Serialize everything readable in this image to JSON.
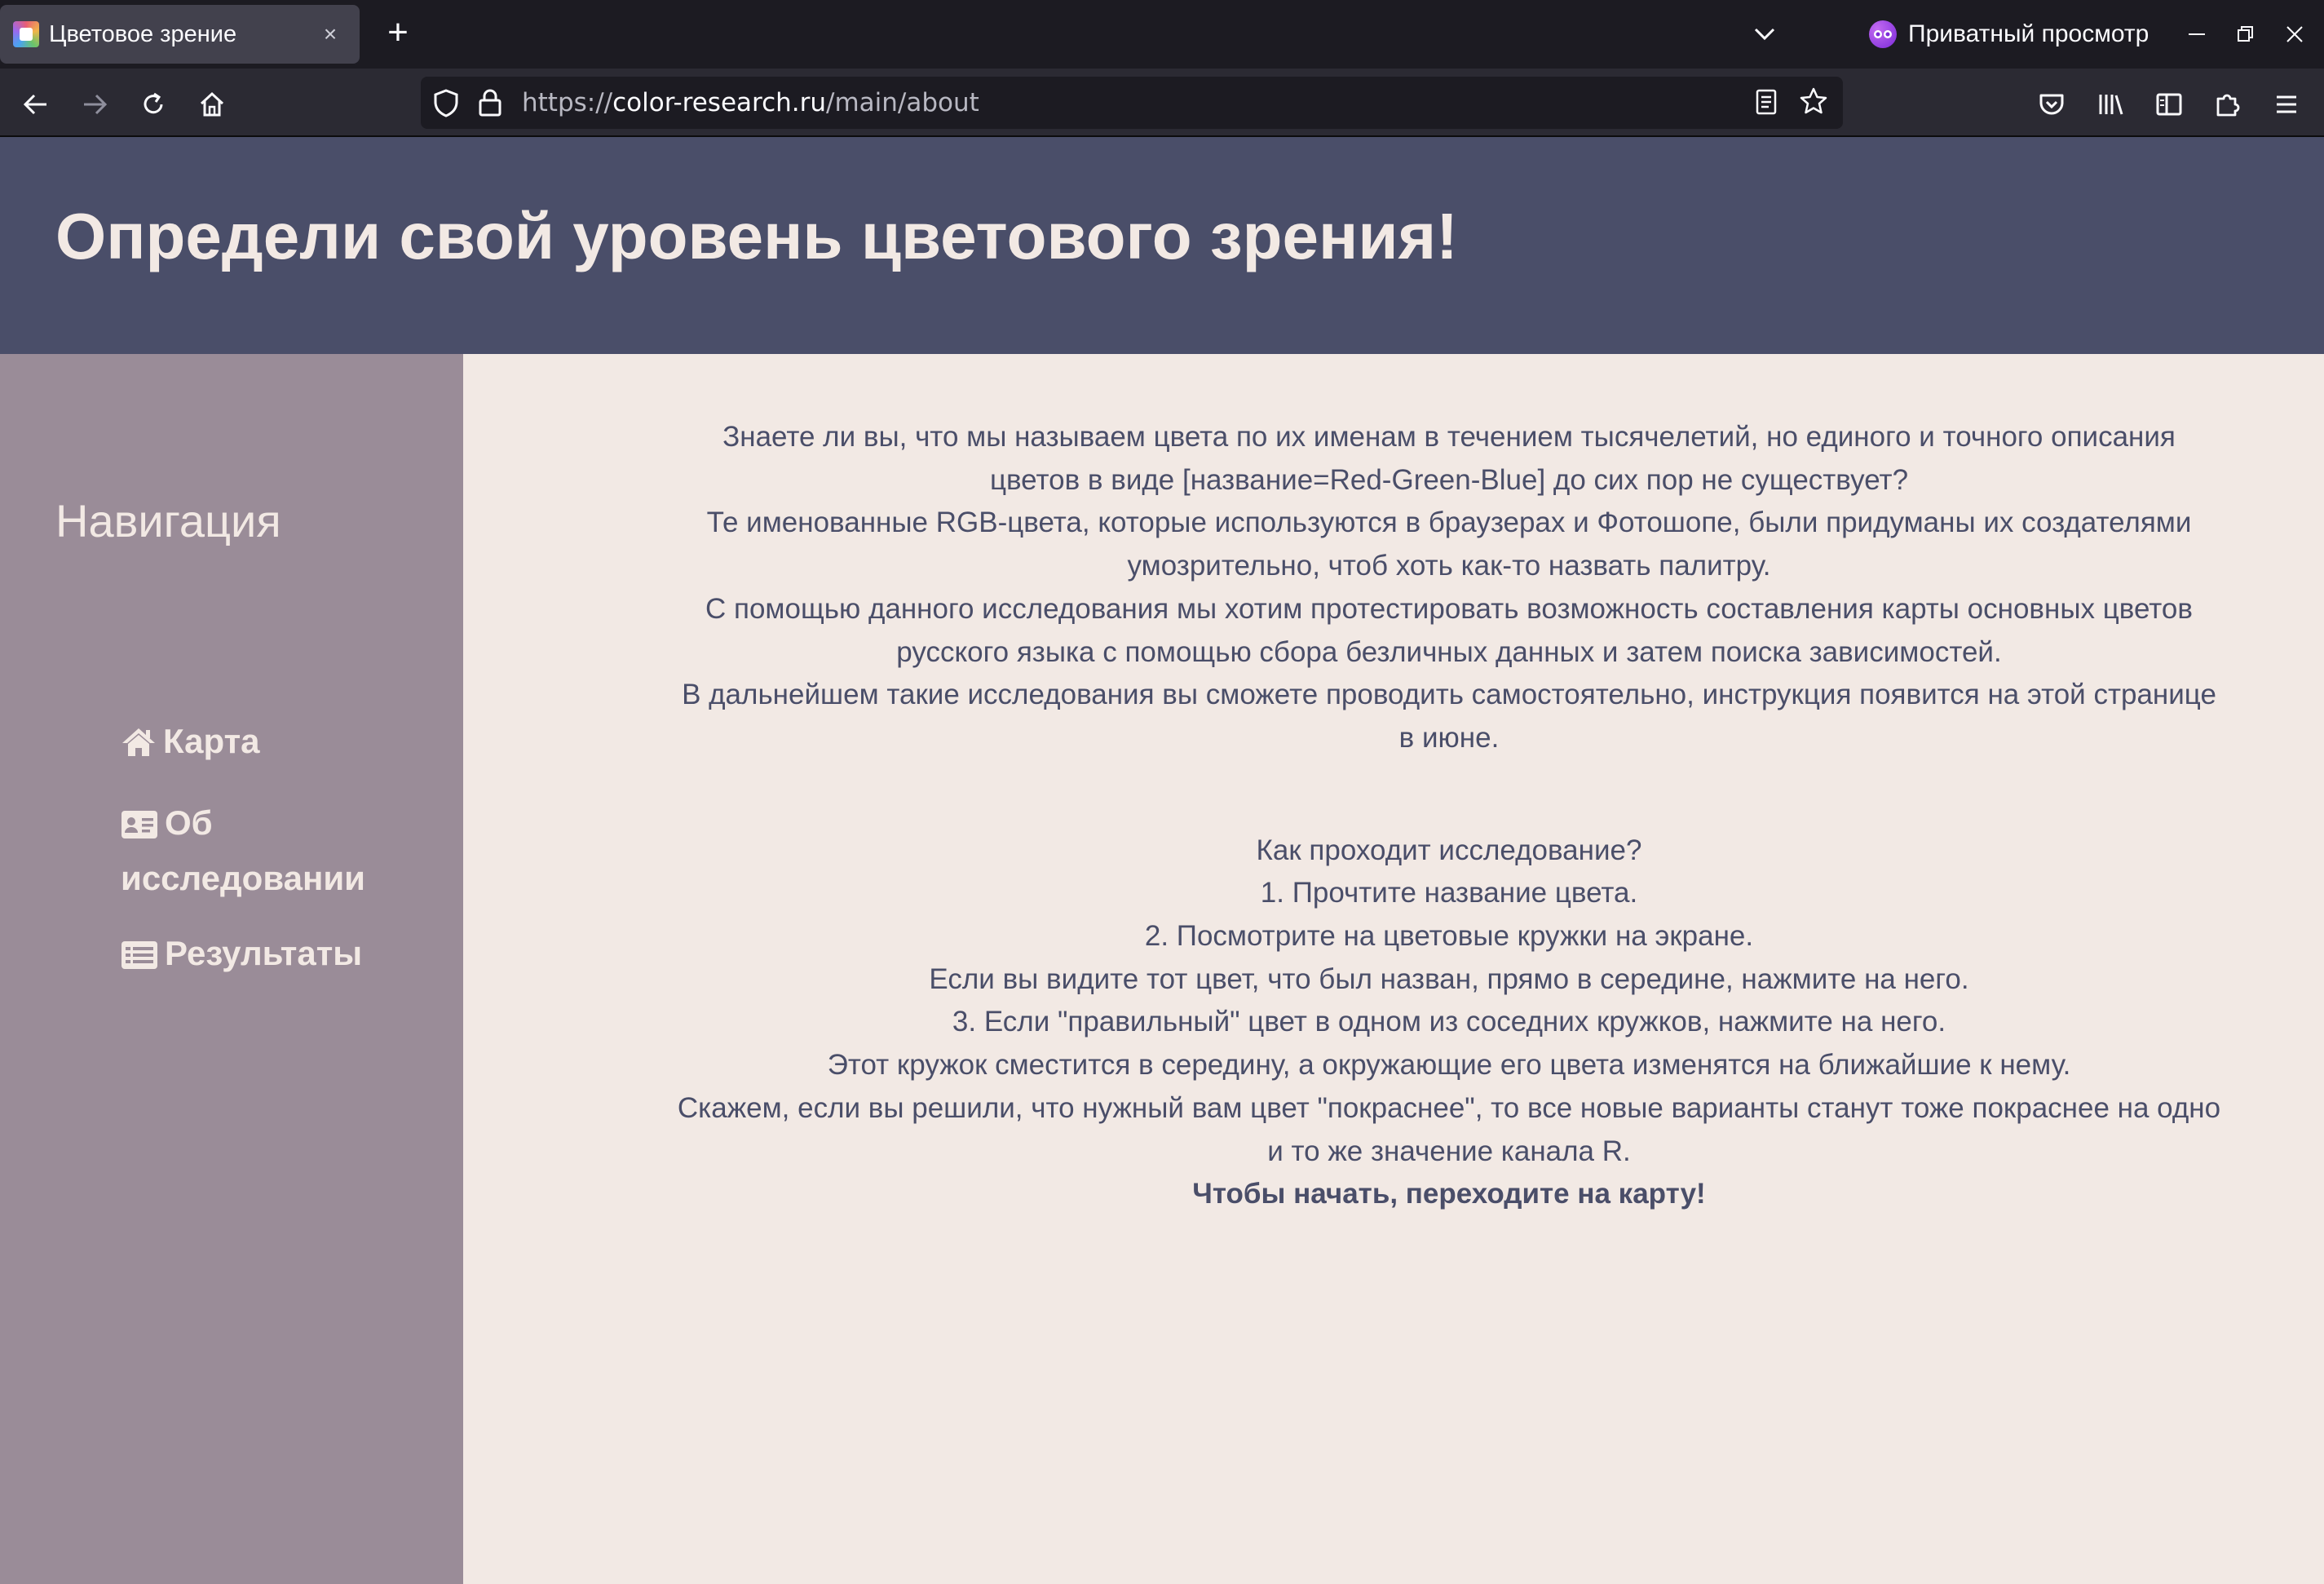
{
  "browser": {
    "tab": {
      "title": "Цветовое зрение",
      "close": "×"
    },
    "new_tab": "+",
    "private_label": "Приватный просмотр",
    "url": {
      "scheme": "https://",
      "host": "color-research.ru",
      "path": "/main/about"
    }
  },
  "site": {
    "title": "Определи свой уровень цветового зрения!",
    "sidebar": {
      "heading": "Навигация",
      "items": [
        {
          "label": "Карта",
          "icon": "home-icon"
        },
        {
          "label": "Об исследовании",
          "icon": "id-card-icon"
        },
        {
          "label": "Результаты",
          "icon": "list-icon"
        }
      ]
    },
    "intro": [
      "Знаете ли вы, что мы называем цвета по их именам в течением тысячелетий, но единого и точного описания цветов в виде [название=Red-Green-Blue] до сих пор не существует?",
      "Те именованные RGB-цвета, которые используются в браузерах и Фотошопе, были придуманы их создателями умозрительно, чтоб хоть как-то назвать палитру.",
      "С помощью данного исследования мы хотим протестировать возможность составления карты основных цветов русского языка с помощью сбора безличных данных и затем поиска зависимостей.",
      "В дальнейшем такие исследования вы сможете проводить самостоятельно, инструкция появится на этой странице в июне."
    ],
    "howto": [
      "Как проходит исследование?",
      "1. Прочтите название цвета.",
      "2. Посмотрите на цветовые кружки на экране.",
      "Если вы видите тот цвет, что был назван, прямо в середине, нажмите на него.",
      "3. Если \"правильный\" цвет в одном из соседних кружков, нажмите на него.",
      "Этот кружок сместится в середину, а окружающие его цвета изменятся на ближайшие к нему.",
      "Скажем, если вы решили, что нужный вам цвет \"покраснее\", то все новые варианты станут тоже покраснее на одно и то же значение канала R."
    ],
    "cta": "Чтобы начать, переходите на карту!"
  },
  "colors": {
    "header_bg": "#4a4e69",
    "sidebar_bg": "#9a8c98",
    "content_bg": "#f2e9e4",
    "text": "#4a4e69",
    "light_text": "#f2e9e4"
  }
}
